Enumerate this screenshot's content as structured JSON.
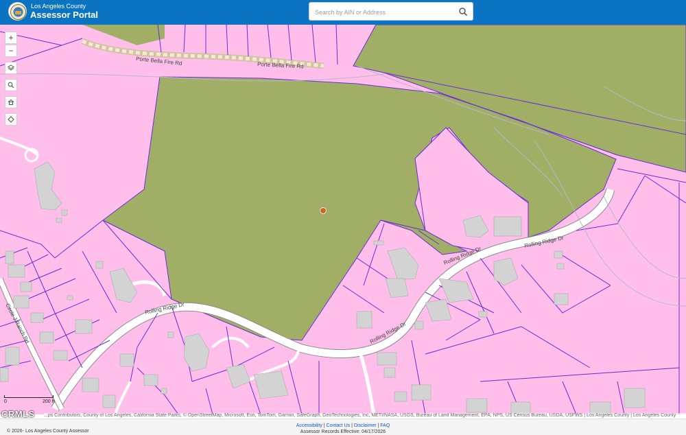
{
  "header": {
    "brand_sup": "Los Angeles County",
    "brand_main": "Assessor Portal",
    "search_placeholder": "Search by AIN or Address",
    "icons": {
      "seal": "county-seal-icon",
      "search": "search-icon"
    }
  },
  "map": {
    "roads": {
      "fire_rd_1": "Porte Bella Fire Rd",
      "fire_rd_2": "Porte Bella Fire Rd",
      "rolling_1": "Rolling Ridge Dr",
      "rolling_2": "Rolling Ridge Dr",
      "rolling_3": "Rolling Ridge Dr",
      "rolling_4": "Rolling Ridge Dr",
      "circle_ranch": "Circle J Ranch Rd"
    },
    "controls": {
      "zoom_in": "+",
      "zoom_out": "−",
      "icons": [
        "layers-icon",
        "search-icon",
        "home-icon",
        "locate-icon"
      ]
    },
    "scale": {
      "left": "0",
      "right": "200 ft"
    },
    "watermark": "CRMLS",
    "attribution": "...ps Contributors, County of Los Angeles, California State Parks, © OpenStreetMap, Microsoft, Esri, TomTom, Garmin, SafeGraph, GeoTechnologies, Inc, METI/NASA, USGS, Bureau of Land Management, EPA, NPS, US Census Bureau, USDA, USFWS | Los Angeles County | Los Angeles County",
    "colors": {
      "parcel_fill": "#ffbfea",
      "open_space": "#a0ae66",
      "parcel_line": "#6a2bd9",
      "marker": "#d3641c"
    }
  },
  "footer": {
    "copyright": "© 2026- Los Angeles County Assessor",
    "accessibility": "Accessibility",
    "sep1": " | ",
    "contact": "Contact Us",
    "sep2": " | ",
    "disclaimer": "Disclaimer",
    "sep3": " | ",
    "faq": "FAQ",
    "effective": "Assessor Records Effective: 04/17/2026"
  }
}
